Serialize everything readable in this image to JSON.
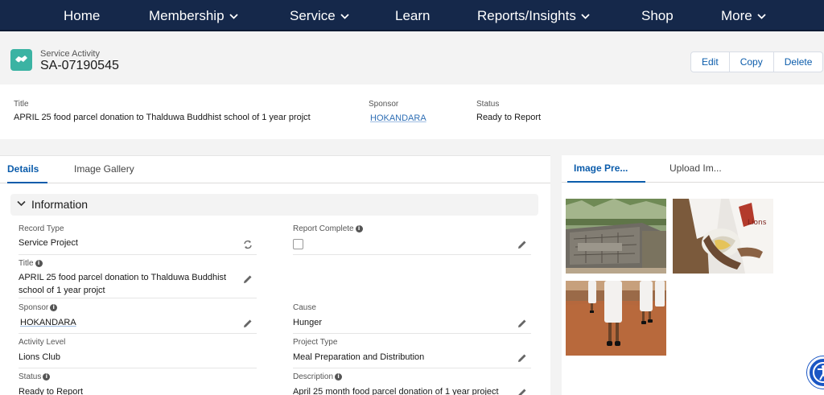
{
  "nav": {
    "items": [
      {
        "label": "Home",
        "dropdown": false
      },
      {
        "label": "Membership",
        "dropdown": true
      },
      {
        "label": "Service",
        "dropdown": true
      },
      {
        "label": "Learn",
        "dropdown": false
      },
      {
        "label": "Reports/Insights",
        "dropdown": true
      },
      {
        "label": "Shop",
        "dropdown": false
      },
      {
        "label": "More",
        "dropdown": true
      }
    ]
  },
  "record": {
    "object_type": "Service Activity",
    "name": "SA-07190545",
    "icon": "handshake-icon",
    "actions": [
      "Edit",
      "Copy",
      "Delete"
    ]
  },
  "highlights": {
    "title_label": "Title",
    "title_value": "APRIL 25 food parcel donation to Thalduwa Buddhist school of 1 year projct",
    "sponsor_label": "Sponsor",
    "sponsor_value": "HOKANDARA",
    "status_label": "Status",
    "status_value": "Ready to Report"
  },
  "left_tabs": [
    "Details",
    "Image Gallery"
  ],
  "right_tabs": [
    "Image Pre...",
    "Upload Im..."
  ],
  "section": {
    "title": "Information"
  },
  "fields": {
    "record_type": {
      "label": "Record Type",
      "value": "Service Project"
    },
    "report_complete": {
      "label": "Report Complete",
      "checked": false
    },
    "title": {
      "label": "Title",
      "value": "APRIL 25 food parcel donation to Thalduwa Buddhist school of 1 year projct"
    },
    "sponsor": {
      "label": "Sponsor",
      "value": "HOKANDARA"
    },
    "cause": {
      "label": "Cause",
      "value": "Hunger"
    },
    "activity_level": {
      "label": "Activity Level",
      "value": "Lions Club"
    },
    "project_type": {
      "label": "Project Type",
      "value": "Meal Preparation and Distribution"
    },
    "status": {
      "label": "Status",
      "value": "Ready to Report"
    },
    "description": {
      "label": "Description",
      "value": "April 25 month food parcel donation of 1 year project"
    }
  },
  "colors": {
    "nav_bg": "#15284a",
    "accent": "#0b5cab",
    "object_icon": "#3bb3a3"
  }
}
